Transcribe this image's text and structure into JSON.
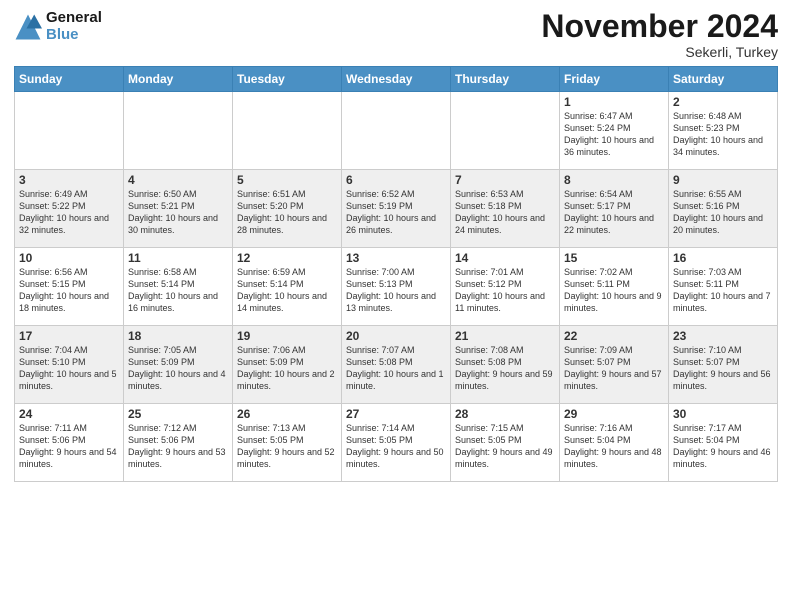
{
  "logo": {
    "line1": "General",
    "line2": "Blue"
  },
  "title": "November 2024",
  "location": "Sekerli, Turkey",
  "days_header": [
    "Sunday",
    "Monday",
    "Tuesday",
    "Wednesday",
    "Thursday",
    "Friday",
    "Saturday"
  ],
  "weeks": [
    [
      {
        "day": "",
        "info": ""
      },
      {
        "day": "",
        "info": ""
      },
      {
        "day": "",
        "info": ""
      },
      {
        "day": "",
        "info": ""
      },
      {
        "day": "",
        "info": ""
      },
      {
        "day": "1",
        "info": "Sunrise: 6:47 AM\nSunset: 5:24 PM\nDaylight: 10 hours and 36 minutes."
      },
      {
        "day": "2",
        "info": "Sunrise: 6:48 AM\nSunset: 5:23 PM\nDaylight: 10 hours and 34 minutes."
      }
    ],
    [
      {
        "day": "3",
        "info": "Sunrise: 6:49 AM\nSunset: 5:22 PM\nDaylight: 10 hours and 32 minutes."
      },
      {
        "day": "4",
        "info": "Sunrise: 6:50 AM\nSunset: 5:21 PM\nDaylight: 10 hours and 30 minutes."
      },
      {
        "day": "5",
        "info": "Sunrise: 6:51 AM\nSunset: 5:20 PM\nDaylight: 10 hours and 28 minutes."
      },
      {
        "day": "6",
        "info": "Sunrise: 6:52 AM\nSunset: 5:19 PM\nDaylight: 10 hours and 26 minutes."
      },
      {
        "day": "7",
        "info": "Sunrise: 6:53 AM\nSunset: 5:18 PM\nDaylight: 10 hours and 24 minutes."
      },
      {
        "day": "8",
        "info": "Sunrise: 6:54 AM\nSunset: 5:17 PM\nDaylight: 10 hours and 22 minutes."
      },
      {
        "day": "9",
        "info": "Sunrise: 6:55 AM\nSunset: 5:16 PM\nDaylight: 10 hours and 20 minutes."
      }
    ],
    [
      {
        "day": "10",
        "info": "Sunrise: 6:56 AM\nSunset: 5:15 PM\nDaylight: 10 hours and 18 minutes."
      },
      {
        "day": "11",
        "info": "Sunrise: 6:58 AM\nSunset: 5:14 PM\nDaylight: 10 hours and 16 minutes."
      },
      {
        "day": "12",
        "info": "Sunrise: 6:59 AM\nSunset: 5:14 PM\nDaylight: 10 hours and 14 minutes."
      },
      {
        "day": "13",
        "info": "Sunrise: 7:00 AM\nSunset: 5:13 PM\nDaylight: 10 hours and 13 minutes."
      },
      {
        "day": "14",
        "info": "Sunrise: 7:01 AM\nSunset: 5:12 PM\nDaylight: 10 hours and 11 minutes."
      },
      {
        "day": "15",
        "info": "Sunrise: 7:02 AM\nSunset: 5:11 PM\nDaylight: 10 hours and 9 minutes."
      },
      {
        "day": "16",
        "info": "Sunrise: 7:03 AM\nSunset: 5:11 PM\nDaylight: 10 hours and 7 minutes."
      }
    ],
    [
      {
        "day": "17",
        "info": "Sunrise: 7:04 AM\nSunset: 5:10 PM\nDaylight: 10 hours and 5 minutes."
      },
      {
        "day": "18",
        "info": "Sunrise: 7:05 AM\nSunset: 5:09 PM\nDaylight: 10 hours and 4 minutes."
      },
      {
        "day": "19",
        "info": "Sunrise: 7:06 AM\nSunset: 5:09 PM\nDaylight: 10 hours and 2 minutes."
      },
      {
        "day": "20",
        "info": "Sunrise: 7:07 AM\nSunset: 5:08 PM\nDaylight: 10 hours and 1 minute."
      },
      {
        "day": "21",
        "info": "Sunrise: 7:08 AM\nSunset: 5:08 PM\nDaylight: 9 hours and 59 minutes."
      },
      {
        "day": "22",
        "info": "Sunrise: 7:09 AM\nSunset: 5:07 PM\nDaylight: 9 hours and 57 minutes."
      },
      {
        "day": "23",
        "info": "Sunrise: 7:10 AM\nSunset: 5:07 PM\nDaylight: 9 hours and 56 minutes."
      }
    ],
    [
      {
        "day": "24",
        "info": "Sunrise: 7:11 AM\nSunset: 5:06 PM\nDaylight: 9 hours and 54 minutes."
      },
      {
        "day": "25",
        "info": "Sunrise: 7:12 AM\nSunset: 5:06 PM\nDaylight: 9 hours and 53 minutes."
      },
      {
        "day": "26",
        "info": "Sunrise: 7:13 AM\nSunset: 5:05 PM\nDaylight: 9 hours and 52 minutes."
      },
      {
        "day": "27",
        "info": "Sunrise: 7:14 AM\nSunset: 5:05 PM\nDaylight: 9 hours and 50 minutes."
      },
      {
        "day": "28",
        "info": "Sunrise: 7:15 AM\nSunset: 5:05 PM\nDaylight: 9 hours and 49 minutes."
      },
      {
        "day": "29",
        "info": "Sunrise: 7:16 AM\nSunset: 5:04 PM\nDaylight: 9 hours and 48 minutes."
      },
      {
        "day": "30",
        "info": "Sunrise: 7:17 AM\nSunset: 5:04 PM\nDaylight: 9 hours and 46 minutes."
      }
    ]
  ]
}
